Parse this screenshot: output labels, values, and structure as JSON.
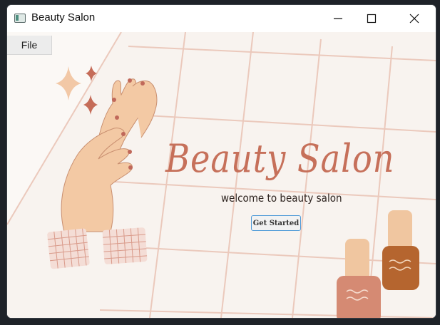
{
  "window": {
    "title": "Beauty Salon",
    "icon": "app-window-icon",
    "controls": [
      "minimize-icon",
      "maximize-icon",
      "close-icon"
    ]
  },
  "menu": {
    "file_label": "File"
  },
  "hero": {
    "brand_title": "Beauty Salon",
    "tagline": "welcome to beauty salon",
    "cta_label": "Get Started"
  },
  "colors": {
    "accent_title": "#c6705a",
    "grid_line": "#e9c9bd",
    "button_border": "#4e9ad8",
    "skin": "#f3c9a4",
    "nail": "#c0685a",
    "polish_pink": "#d58a73",
    "polish_brown": "#b5652f",
    "cap": "#f0c6a0"
  }
}
